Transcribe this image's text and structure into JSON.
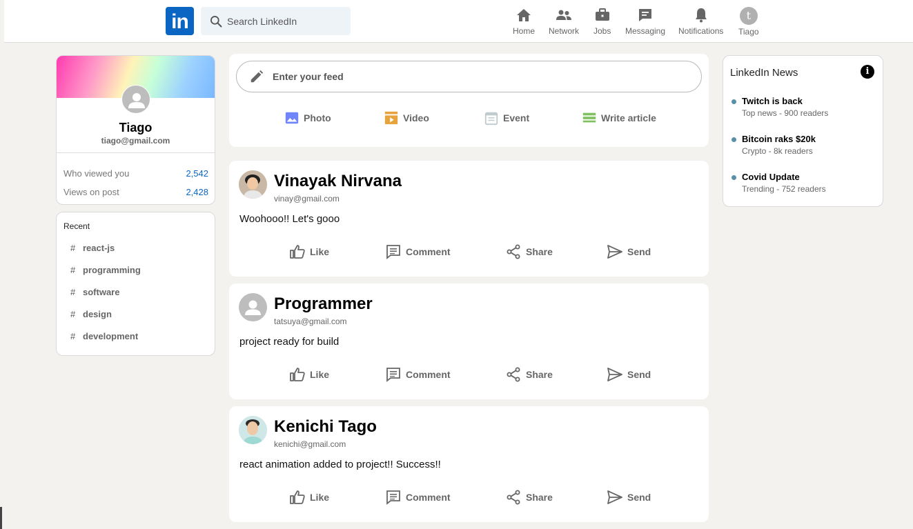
{
  "header": {
    "logo_text": "in",
    "search_placeholder": "Search LinkedIn",
    "nav": [
      {
        "label": "Home",
        "icon": "home-icon"
      },
      {
        "label": "Network",
        "icon": "network-icon"
      },
      {
        "label": "Jobs",
        "icon": "briefcase-icon"
      },
      {
        "label": "Messaging",
        "icon": "message-icon"
      },
      {
        "label": "Notifications",
        "icon": "bell-icon"
      },
      {
        "label": "Tiago",
        "icon": "avatar-icon",
        "initial": "t"
      }
    ]
  },
  "profile": {
    "name": "Tiago",
    "email": "tiago@gmail.com",
    "stats": [
      {
        "label": "Who viewed you",
        "value": "2,542"
      },
      {
        "label": "Views on post",
        "value": "2,428"
      }
    ]
  },
  "recent": {
    "title": "Recent",
    "items": [
      "react-js",
      "programming",
      "software",
      "design",
      "development"
    ]
  },
  "composer": {
    "placeholder": "Enter your feed",
    "options": [
      {
        "label": "Photo",
        "color": "#7085f9"
      },
      {
        "label": "Video",
        "color": "#e7a33e"
      },
      {
        "label": "Event",
        "color": "#c0cbcd"
      },
      {
        "label": "Write article",
        "color": "#7fc15e"
      }
    ]
  },
  "posts": [
    {
      "name": "Vinayak Nirvana",
      "email": "vinay@gmail.com",
      "message": "Woohooo!! Let's gooo"
    },
    {
      "name": "Programmer",
      "email": "tatsuya@gmail.com",
      "message": "project ready for build"
    },
    {
      "name": "Kenichi Tago",
      "email": "kenichi@gmail.com",
      "message": "react animation added to project!! Success!!"
    }
  ],
  "post_actions": [
    "Like",
    "Comment",
    "Share",
    "Send"
  ],
  "news": {
    "title": "LinkedIn News",
    "items": [
      {
        "headline": "Twitch is back",
        "sub": "Top news - 900 readers"
      },
      {
        "headline": "Bitcoin raks $20k",
        "sub": "Crypto - 8k readers"
      },
      {
        "headline": "Covid Update",
        "sub": "Trending - 752 readers"
      }
    ]
  }
}
